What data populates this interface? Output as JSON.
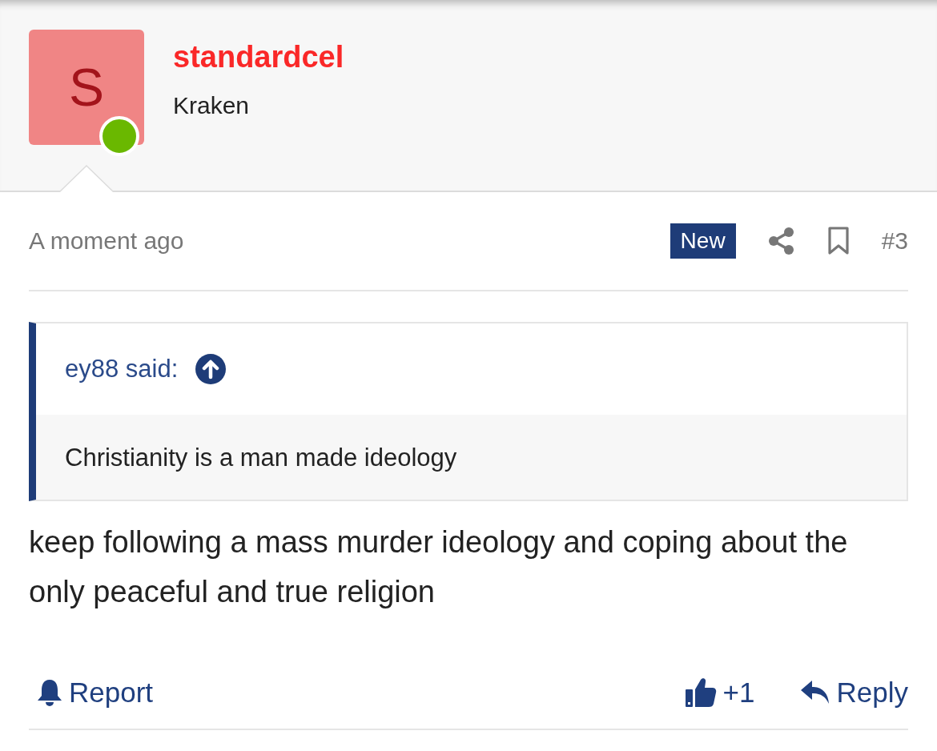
{
  "author": {
    "avatar_letter": "S",
    "online": true,
    "username": "standardcel",
    "title": "Kraken"
  },
  "post": {
    "time": "A moment ago",
    "badge": "New",
    "number": "#3",
    "quote": {
      "author": "ey88 said:",
      "text": "Christianity is a man made ideology"
    },
    "body": "keep following a mass murder ideology and coping about the only peaceful and true religion",
    "actions": {
      "report": "Report",
      "reaction_count": "+1",
      "reply": "Reply"
    }
  }
}
